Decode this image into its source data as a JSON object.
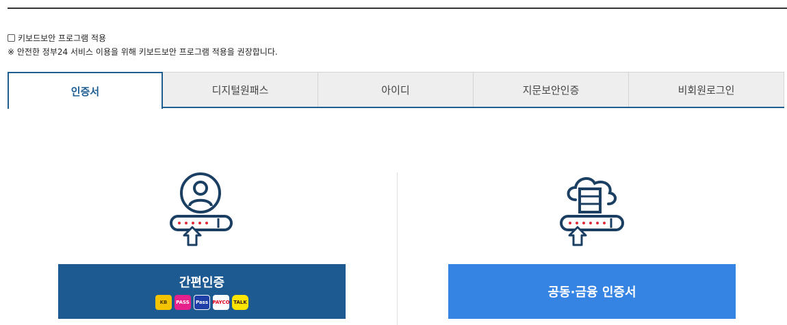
{
  "keyboard_security": {
    "label": "키보드보안 프로그램 적용",
    "checked": false,
    "notice": "※ 안전한 정부24 서비스 이용을 위해 키보드보안 프로그램 적용을 권장합니다."
  },
  "tabs": [
    {
      "label": "인증서",
      "active": true
    },
    {
      "label": "디지털원패스",
      "active": false
    },
    {
      "label": "아이디",
      "active": false
    },
    {
      "label": "지문보안인증",
      "active": false
    },
    {
      "label": "비회원로그인",
      "active": false
    }
  ],
  "login_options": {
    "simple_auth": {
      "label": "간편인증",
      "icon": "user-password-icon",
      "providers": [
        {
          "name": "kb-icon",
          "text": "KB"
        },
        {
          "name": "pass-icon",
          "text": "PASS"
        },
        {
          "name": "samsung-pass-icon",
          "text": "Pass"
        },
        {
          "name": "payco-icon",
          "text": "PAYCO"
        },
        {
          "name": "kakao-talk-icon",
          "text": "TALK"
        }
      ]
    },
    "joint_cert": {
      "label": "공동·금융 인증서",
      "icon": "cloud-server-password-icon"
    }
  },
  "colors": {
    "accent": "#1c5d92",
    "simple_button": "#1d5a91",
    "cert_button": "#3584e4",
    "tab_bg": "#eeeeee"
  }
}
